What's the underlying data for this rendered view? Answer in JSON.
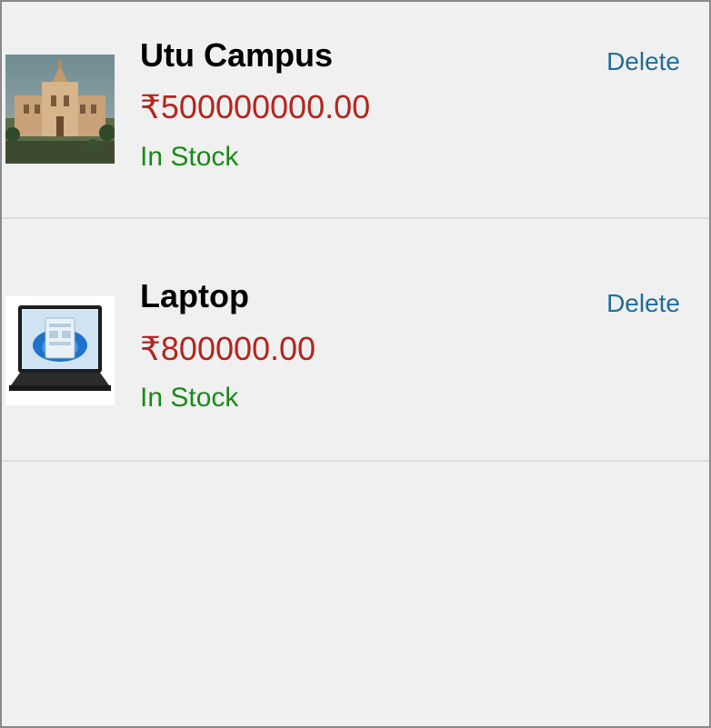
{
  "cart": {
    "items": [
      {
        "name": "Utu Campus",
        "price": "₹500000000.00",
        "stock": "In Stock",
        "delete_label": "Delete",
        "image_icon": "campus-building-image"
      },
      {
        "name": "Laptop",
        "price": "₹800000.00",
        "stock": "In Stock",
        "delete_label": "Delete",
        "image_icon": "laptop-image"
      }
    ]
  },
  "colors": {
    "panel_bg": "#f0f0f0",
    "price": "#b3261e",
    "stock": "#1a8a1a",
    "delete": "#1f6f9b"
  }
}
